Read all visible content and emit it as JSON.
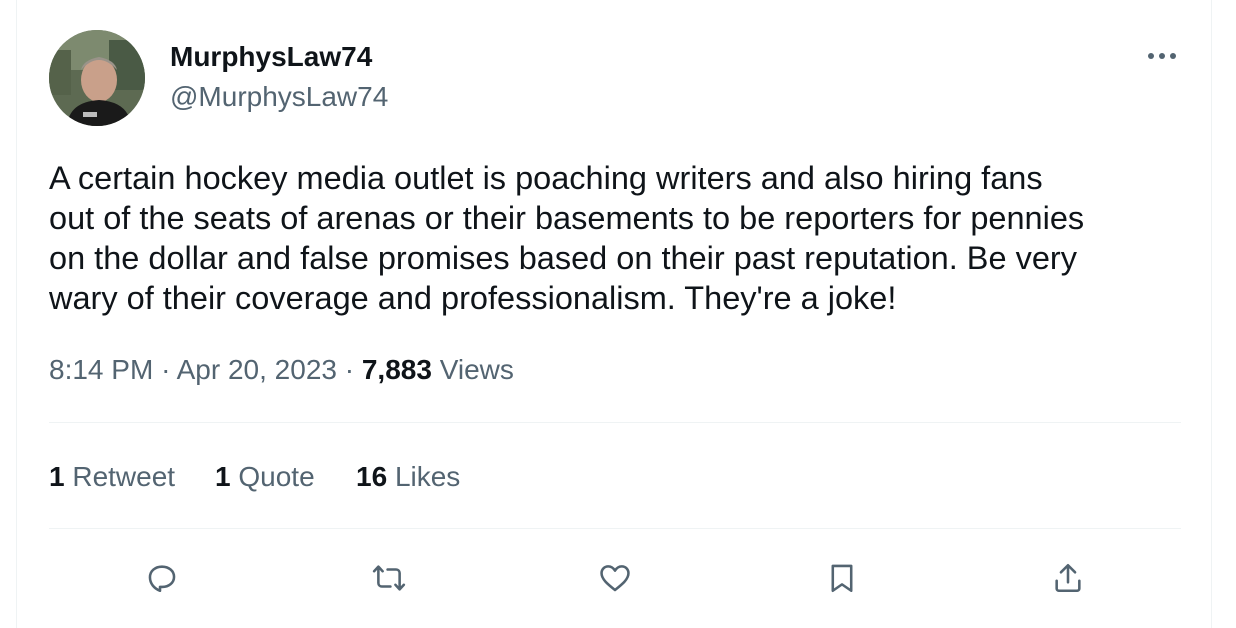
{
  "tweet": {
    "author": {
      "display_name": "MurphysLaw74",
      "handle": "@MurphysLaw74"
    },
    "text": "A certain hockey media outlet is poaching writers and also hiring fans\nout of the seats of arenas or their basements to be reporters for pennies\non the dollar and false promises based on their past reputation. Be very\nwary of their coverage and professionalism. They're a joke!",
    "time": "8:14 PM",
    "date": "Apr 20, 2023",
    "separator": "·",
    "views_count": "7,883",
    "views_label": "Views"
  },
  "stats": {
    "retweets_count": "1",
    "retweets_label": "Retweet",
    "quotes_count": "1",
    "quotes_label": "Quote",
    "likes_count": "16",
    "likes_label": "Likes"
  },
  "actions": {
    "icons": [
      "reply-icon",
      "retweet-icon",
      "like-icon",
      "bookmark-icon",
      "share-icon"
    ]
  },
  "colors": {
    "primary_text": "#0f1419",
    "secondary_text": "#536471",
    "divider": "#eff3f4"
  }
}
